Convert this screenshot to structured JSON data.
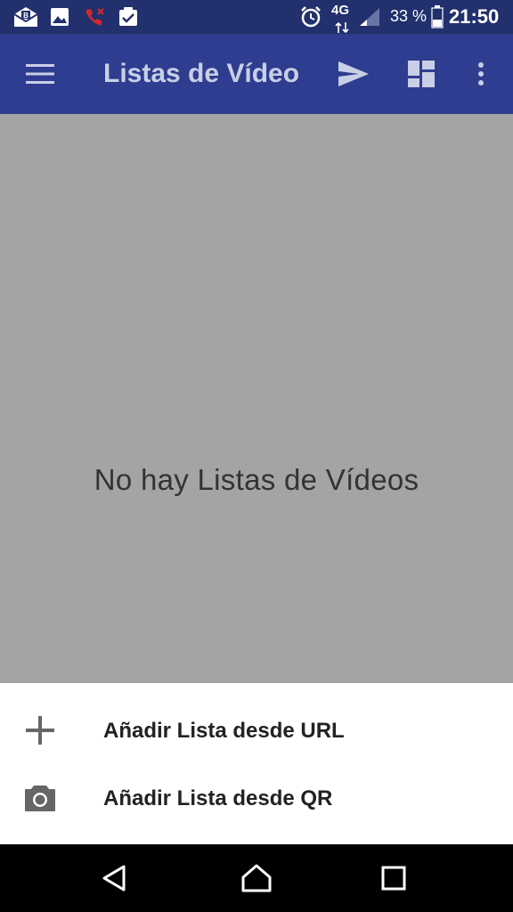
{
  "status_bar": {
    "battery_percent": "33 %",
    "network_type": "4G",
    "time": "21:50",
    "icons": [
      "mail-icon",
      "image-icon",
      "missed-call-icon",
      "task-icon",
      "alarm-icon",
      "signal-icon",
      "battery-icon"
    ]
  },
  "app_bar": {
    "title": "Listas de Vídeo",
    "icons": [
      "menu-icon",
      "send-icon",
      "dashboard-icon",
      "more-vert-icon"
    ]
  },
  "content": {
    "empty_message": "No hay Listas de Vídeos"
  },
  "bottom_sheet": {
    "items": [
      {
        "label": "Añadir Lista desde URL",
        "icon": "add-icon"
      },
      {
        "label": "Añadir Lista desde QR",
        "icon": "camera-icon"
      }
    ]
  },
  "nav_bar": {
    "icons": [
      "back-icon",
      "home-icon",
      "recents-icon"
    ]
  },
  "colors": {
    "status_bar": "#22306e",
    "app_bar": "#2e3d8f",
    "title_text": "#c9cfe6",
    "scrim": "#a4a4a4",
    "sheet": "#ffffff",
    "nav_bar": "#000000"
  }
}
